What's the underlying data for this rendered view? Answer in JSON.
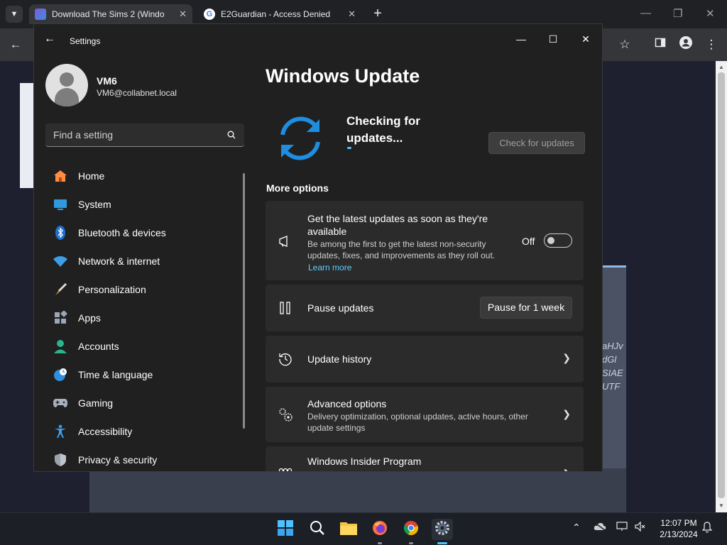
{
  "browser": {
    "tabs": [
      {
        "title": "Download The Sims 2 (Windo",
        "active": true
      },
      {
        "title": "E2Guardian - Access Denied",
        "active": false
      }
    ],
    "background_text": [
      "aHJv",
      "dGl",
      "SIAE",
      "UTF"
    ]
  },
  "settings": {
    "window_title": "Settings",
    "user": {
      "name": "VM6",
      "email": "VM6@collabnet.local"
    },
    "search_placeholder": "Find a setting",
    "nav": [
      {
        "label": "Home",
        "icon": "home-icon"
      },
      {
        "label": "System",
        "icon": "system-icon"
      },
      {
        "label": "Bluetooth & devices",
        "icon": "bluetooth-icon"
      },
      {
        "label": "Network & internet",
        "icon": "wifi-icon"
      },
      {
        "label": "Personalization",
        "icon": "brush-icon"
      },
      {
        "label": "Apps",
        "icon": "apps-icon"
      },
      {
        "label": "Accounts",
        "icon": "accounts-icon"
      },
      {
        "label": "Time & language",
        "icon": "globe-clock-icon"
      },
      {
        "label": "Gaming",
        "icon": "gamepad-icon"
      },
      {
        "label": "Accessibility",
        "icon": "accessibility-icon"
      },
      {
        "label": "Privacy & security",
        "icon": "shield-icon"
      }
    ],
    "page_title": "Windows Update",
    "status": "Checking for updates...",
    "check_button": "Check for updates",
    "more_options_heading": "More options",
    "latest_updates": {
      "title": "Get the latest updates as soon as they're available",
      "description": "Be among the first to get the latest non-security updates, fixes, and improvements as they roll out.",
      "link": "Learn more",
      "toggle_label": "Off",
      "toggle_on": false
    },
    "pause": {
      "title": "Pause updates",
      "button": "Pause for 1 week"
    },
    "history": {
      "title": "Update history"
    },
    "advanced": {
      "title": "Advanced options",
      "description": "Delivery optimization, optional updates, active hours, other update settings"
    },
    "insider": {
      "title": "Windows Insider Program"
    },
    "progress_fraction": 0.04
  },
  "taskbar": {
    "time": "12:07 PM",
    "date": "2/13/2024",
    "pinned": [
      "start-icon",
      "search-icon",
      "file-explorer-icon",
      "firefox-icon",
      "chrome-icon",
      "settings-app-icon"
    ]
  },
  "colors": {
    "accent": "#4cc2ff",
    "link": "#60cdff",
    "window_bg": "#202020",
    "card_bg": "#2b2b2b"
  }
}
